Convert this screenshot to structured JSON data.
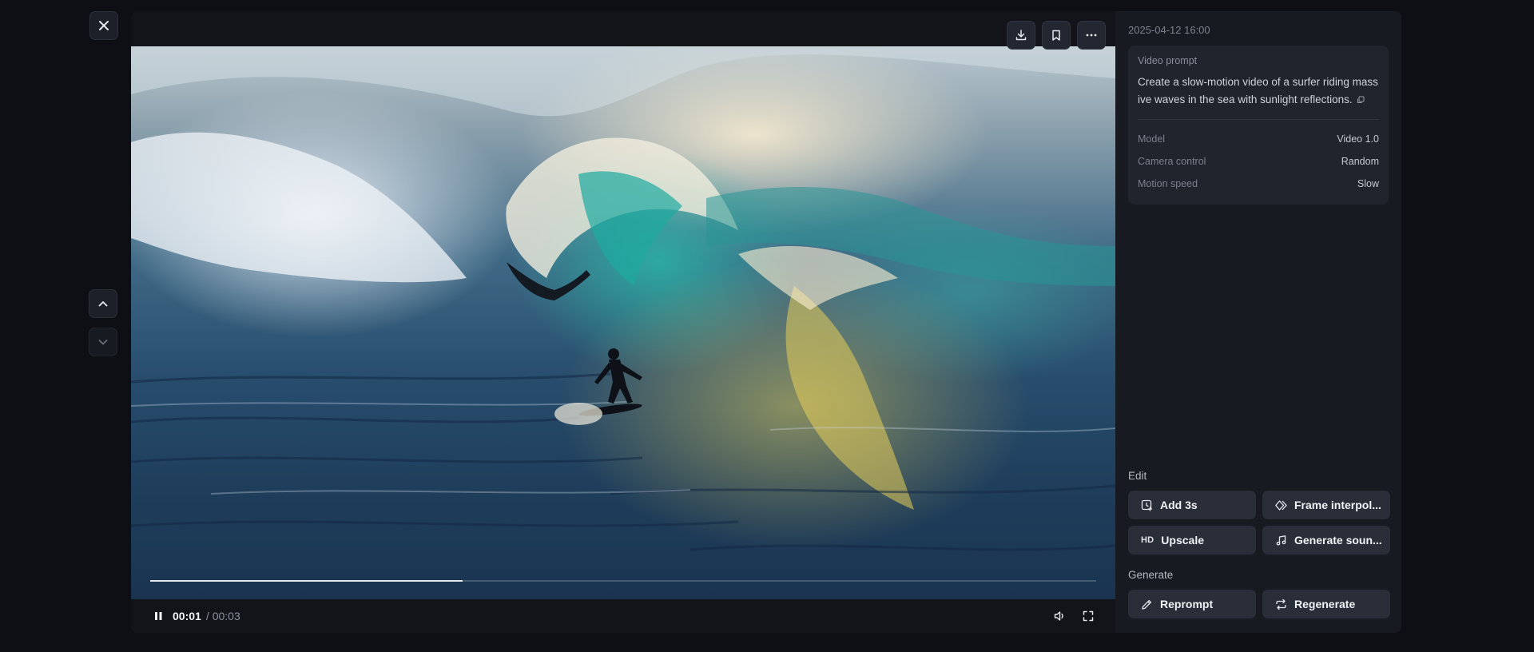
{
  "nav": {
    "close_icon": "close-icon",
    "prev_icon": "chevron-up-icon",
    "next_icon": "chevron-down-icon"
  },
  "toolbar": {
    "download_icon": "download-icon",
    "bookmark_icon": "bookmark-icon",
    "more_icon": "more-icon"
  },
  "player": {
    "current_time": "00:01",
    "separator": "/",
    "total_time": "00:03",
    "progress": 0.33
  },
  "details": {
    "date": "2025-04-12 16:00",
    "prompt_label": "Video prompt",
    "prompt_text": "Create a slow-motion video of a surfer riding massive waves in the sea with sunlight reflections.",
    "meta": [
      {
        "key": "Model",
        "value": "Video 1.0"
      },
      {
        "key": "Camera control",
        "value": "Random"
      },
      {
        "key": "Motion speed",
        "value": "Slow"
      }
    ]
  },
  "edit": {
    "title": "Edit",
    "actions": [
      {
        "label": "Add 3s",
        "icon": "add-time-icon"
      },
      {
        "label": "Frame interpol...",
        "icon": "diamond-icon"
      },
      {
        "label": "Upscale",
        "icon": "HD"
      },
      {
        "label": "Generate soun...",
        "icon": "music-note-icon"
      }
    ]
  },
  "generate": {
    "title": "Generate",
    "actions": [
      {
        "label": "Reprompt",
        "icon": "pencil-icon"
      },
      {
        "label": "Regenerate",
        "icon": "repeat-icon"
      }
    ]
  },
  "colors": {
    "background": "#0d0f14",
    "panel": "#181a21",
    "button": "#2a2e38"
  }
}
